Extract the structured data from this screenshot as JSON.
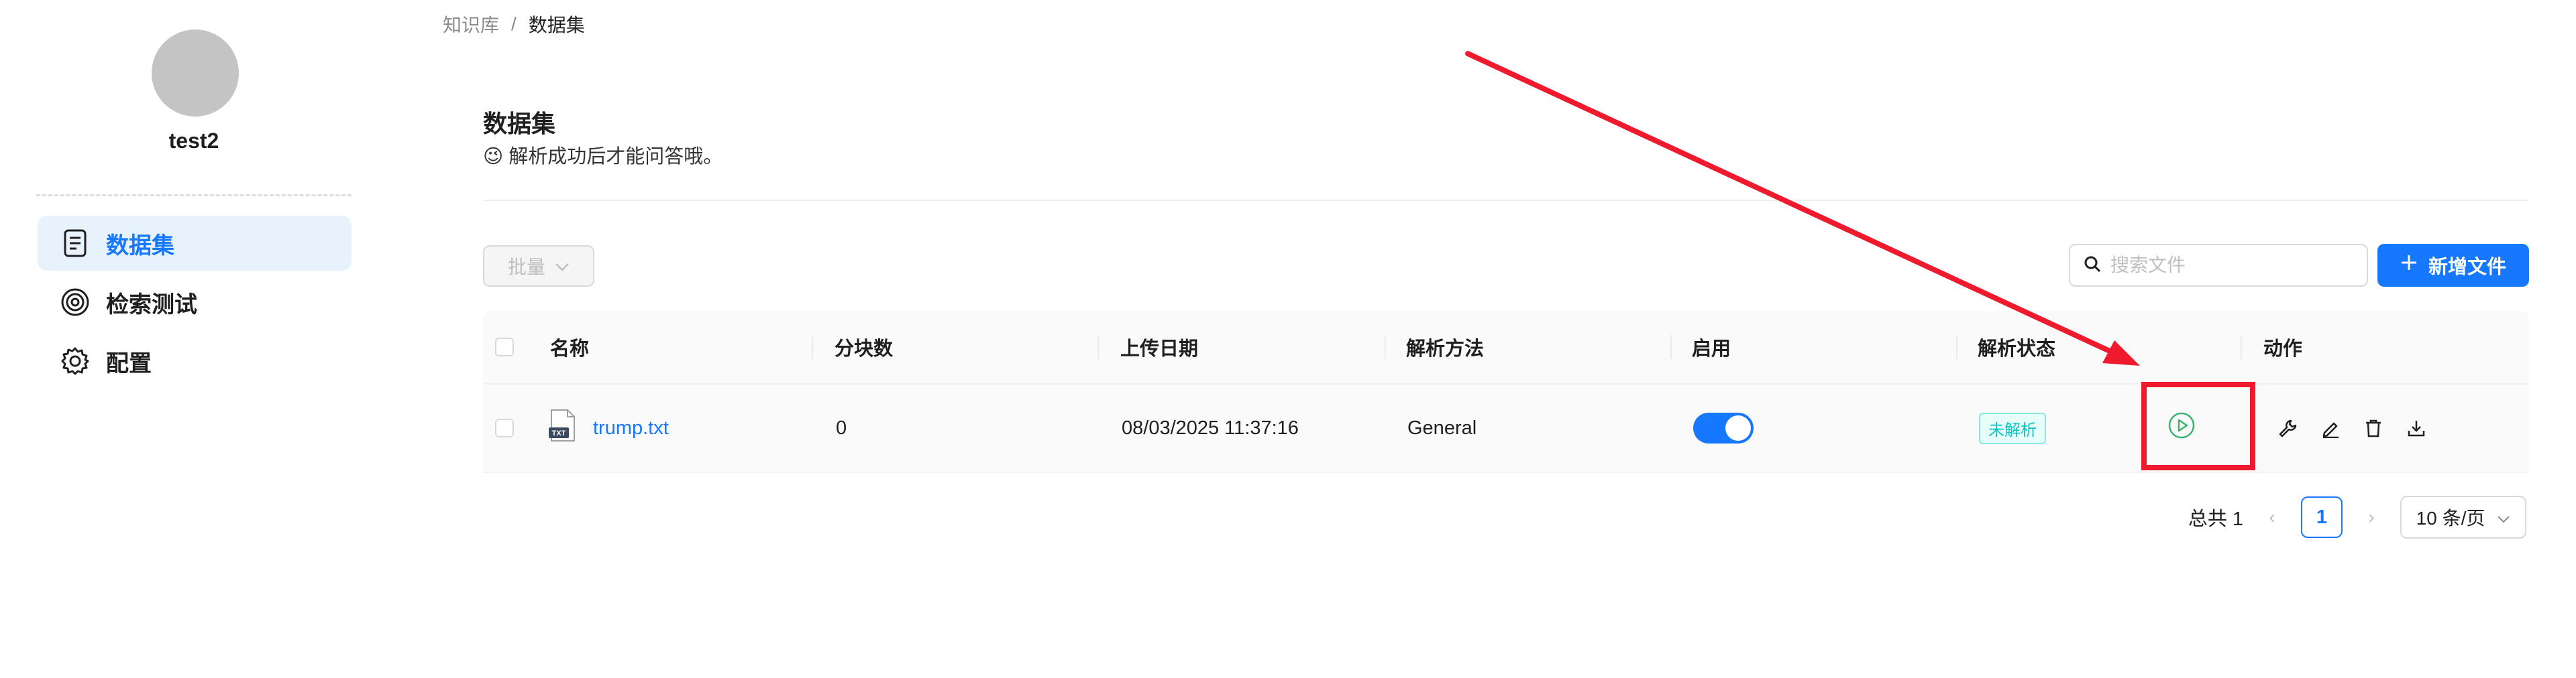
{
  "sidebar": {
    "username": "test2",
    "items": [
      {
        "label": "数据集",
        "icon": "document-icon",
        "active": true
      },
      {
        "label": "检索测试",
        "icon": "target-icon",
        "active": false
      },
      {
        "label": "配置",
        "icon": "gear-icon",
        "active": false
      }
    ]
  },
  "breadcrumb": {
    "parent": "知识库",
    "separator": "/",
    "current": "数据集"
  },
  "header": {
    "title": "数据集",
    "subtitle": "😉 解析成功后才能问答哦。"
  },
  "toolbar": {
    "batch_label": "批量",
    "search_placeholder": "搜索文件",
    "add_label": "新增文件"
  },
  "table": {
    "columns": [
      "名称",
      "分块数",
      "上传日期",
      "解析方法",
      "启用",
      "解析状态",
      "动作"
    ],
    "rows": [
      {
        "name": "trump.txt",
        "file_badge": "TXT",
        "chunks": "0",
        "upload_date": "08/03/2025 11:37:16",
        "parse_method": "General",
        "enabled": true,
        "status": "未解析"
      }
    ]
  },
  "pagination": {
    "total": "总共 1",
    "current": "1",
    "page_size": "10 条/页"
  },
  "colors": {
    "accent": "#1677ff",
    "annotation": "#ef1a2d",
    "status_teal": "#13c2c2"
  }
}
